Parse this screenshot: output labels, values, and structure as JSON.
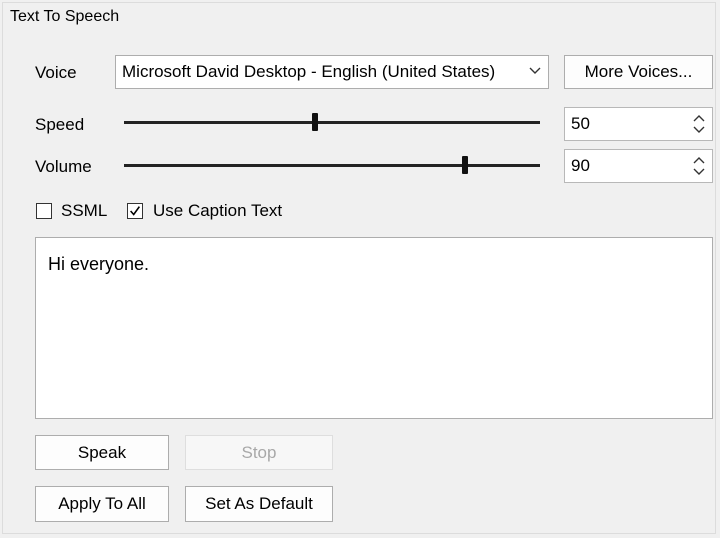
{
  "panel": {
    "title": "Text To Speech"
  },
  "voice": {
    "label": "Voice",
    "selected": "Microsoft David Desktop - English (United States)",
    "more_button": "More Voices..."
  },
  "speed": {
    "label": "Speed",
    "value": "50",
    "level": 0.5
  },
  "volume": {
    "label": "Volume",
    "value": "90",
    "level": 0.9
  },
  "options": {
    "ssml_label": "SSML",
    "ssml_checked": false,
    "caption_label": "Use Caption Text",
    "caption_checked": true
  },
  "text": {
    "content": "Hi everyone."
  },
  "buttons": {
    "speak": "Speak",
    "stop": "Stop",
    "apply_all": "Apply To All",
    "set_default": "Set As Default"
  }
}
